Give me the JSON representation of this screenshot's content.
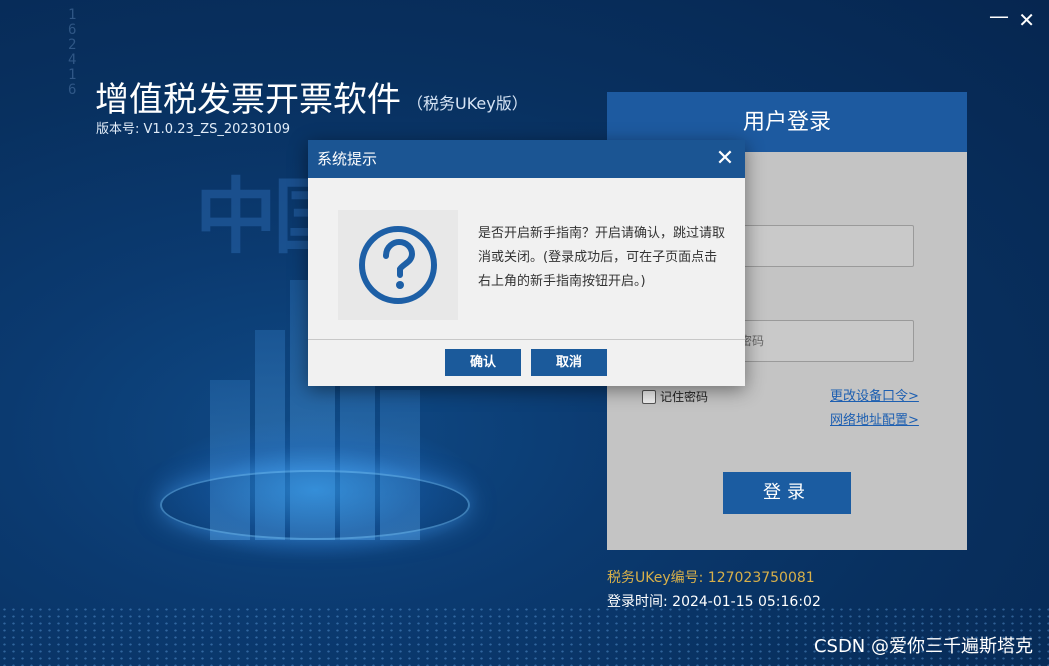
{
  "window": {
    "minimize_glyph": "—",
    "close_glyph": "✕"
  },
  "app": {
    "title": "增值税发票开票软件",
    "subtitle": "（税务UKey版）",
    "version_label": "版本号: V1.0.23_ZS_20230109"
  },
  "background": {
    "decor_text": "中国",
    "decor_numbers": "162416"
  },
  "login": {
    "header": "用户登录",
    "password_placeholder": "密码",
    "remember_label": "记住密码",
    "link_change_device": "更改设备口令>",
    "link_network_config": "网络地址配置>",
    "login_button": "登录",
    "ukey_label": "税务UKey编号: 127023750081",
    "login_time": "登录时间: 2024-01-15 05:16:02"
  },
  "dialog": {
    "title": "系统提示",
    "close_glyph": "✕",
    "icon": "question-circle-icon",
    "message": "是否开启新手指南？开启请确认，跳过请取消或关闭。(登录成功后，可在子页面点击右上角的新手指南按钮开启。)",
    "ok_label": "确认",
    "cancel_label": "取消"
  },
  "watermark": "CSDN @爱你三千遍斯塔克",
  "colors": {
    "primary_blue": "#1b5593",
    "ukey_gold": "#d8b04a",
    "link_blue": "#1d5fb1"
  }
}
